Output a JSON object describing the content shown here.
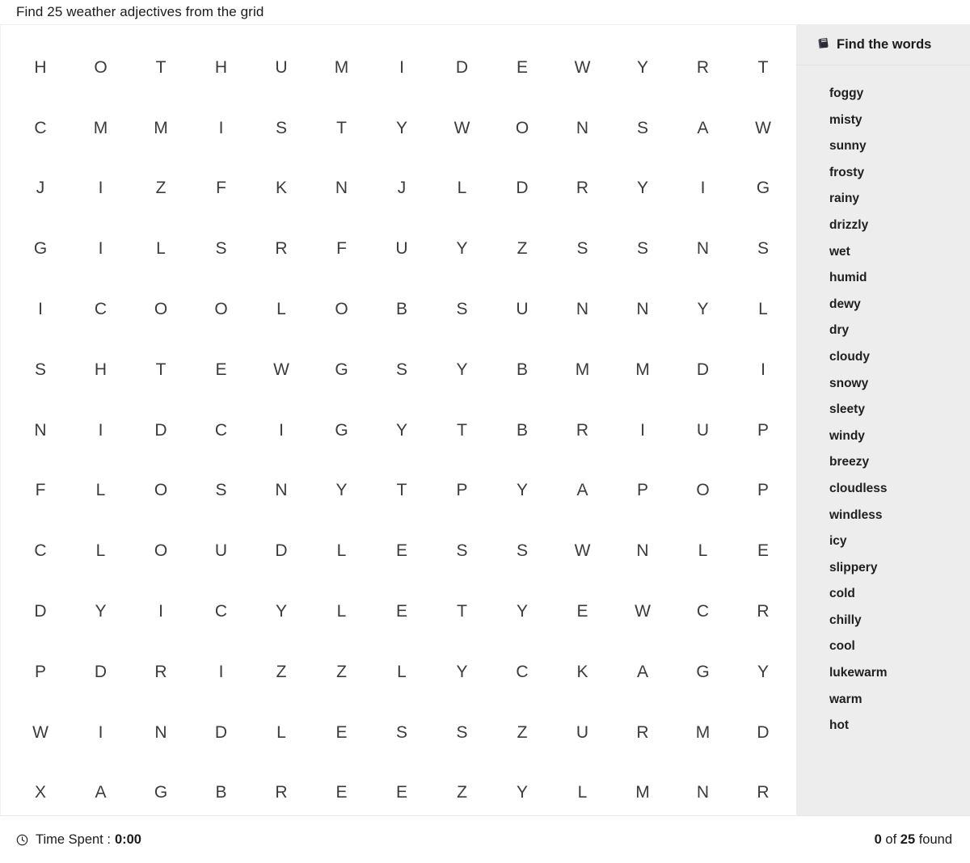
{
  "header": {
    "title": "Find 25 weather adjectives from the grid"
  },
  "grid": {
    "rows": 13,
    "cols": 13,
    "letters": [
      [
        "H",
        "O",
        "T",
        "H",
        "U",
        "M",
        "I",
        "D",
        "E",
        "W",
        "Y",
        "R",
        "T"
      ],
      [
        "C",
        "M",
        "M",
        "I",
        "S",
        "T",
        "Y",
        "W",
        "O",
        "N",
        "S",
        "A",
        "W"
      ],
      [
        "J",
        "I",
        "Z",
        "F",
        "K",
        "N",
        "J",
        "L",
        "D",
        "R",
        "Y",
        "I",
        "G"
      ],
      [
        "G",
        "I",
        "L",
        "S",
        "R",
        "F",
        "U",
        "Y",
        "Z",
        "S",
        "S",
        "N",
        "S"
      ],
      [
        "I",
        "C",
        "O",
        "O",
        "L",
        "O",
        "B",
        "S",
        "U",
        "N",
        "N",
        "Y",
        "L"
      ],
      [
        "S",
        "H",
        "T",
        "E",
        "W",
        "G",
        "S",
        "Y",
        "B",
        "M",
        "M",
        "D",
        "I"
      ],
      [
        "N",
        "I",
        "D",
        "C",
        "I",
        "G",
        "Y",
        "T",
        "B",
        "R",
        "I",
        "U",
        "P"
      ],
      [
        "F",
        "L",
        "O",
        "S",
        "N",
        "Y",
        "T",
        "P",
        "Y",
        "A",
        "P",
        "O",
        "P"
      ],
      [
        "C",
        "L",
        "O",
        "U",
        "D",
        "L",
        "E",
        "S",
        "S",
        "W",
        "N",
        "L",
        "E"
      ],
      [
        "D",
        "Y",
        "I",
        "C",
        "Y",
        "L",
        "E",
        "T",
        "Y",
        "E",
        "W",
        "C",
        "R"
      ],
      [
        "P",
        "D",
        "R",
        "I",
        "Z",
        "Z",
        "L",
        "Y",
        "C",
        "K",
        "A",
        "G",
        "Y"
      ],
      [
        "W",
        "I",
        "N",
        "D",
        "L",
        "E",
        "S",
        "S",
        "Z",
        "U",
        "R",
        "M",
        "D"
      ],
      [
        "X",
        "A",
        "G",
        "B",
        "R",
        "E",
        "E",
        "Z",
        "Y",
        "L",
        "M",
        "N",
        "R"
      ]
    ]
  },
  "sidebar": {
    "icon": "book-icon",
    "title": "Find the words",
    "words": [
      {
        "text": "foggy",
        "found": false
      },
      {
        "text": "misty",
        "found": false
      },
      {
        "text": "sunny",
        "found": false
      },
      {
        "text": "frosty",
        "found": false
      },
      {
        "text": "rainy",
        "found": false
      },
      {
        "text": "drizzly",
        "found": false
      },
      {
        "text": "wet",
        "found": false
      },
      {
        "text": "humid",
        "found": false
      },
      {
        "text": "dewy",
        "found": false
      },
      {
        "text": "dry",
        "found": false
      },
      {
        "text": "cloudy",
        "found": false
      },
      {
        "text": "snowy",
        "found": false
      },
      {
        "text": "sleety",
        "found": false
      },
      {
        "text": "windy",
        "found": false
      },
      {
        "text": "breezy",
        "found": false
      },
      {
        "text": "cloudless",
        "found": false
      },
      {
        "text": "windless",
        "found": false
      },
      {
        "text": "icy",
        "found": false
      },
      {
        "text": "slippery",
        "found": false
      },
      {
        "text": "cold",
        "found": false
      },
      {
        "text": "chilly",
        "found": false
      },
      {
        "text": "cool",
        "found": false
      },
      {
        "text": "lukewarm",
        "found": false
      },
      {
        "text": "warm",
        "found": false
      },
      {
        "text": "hot",
        "found": false
      }
    ]
  },
  "footer": {
    "clock_icon": "clock-icon",
    "timer_label": "Time Spent :",
    "timer_value": "0:00",
    "found_count": "0",
    "found_separator": " of ",
    "total_count": "25",
    "found_suffix": " found"
  },
  "colors": {
    "page_background": "#ffffff",
    "sidebar_background": "#ededed",
    "letter": "#3b3b3b",
    "text": "#1b1b1b",
    "divider": "#e6e8ea"
  }
}
